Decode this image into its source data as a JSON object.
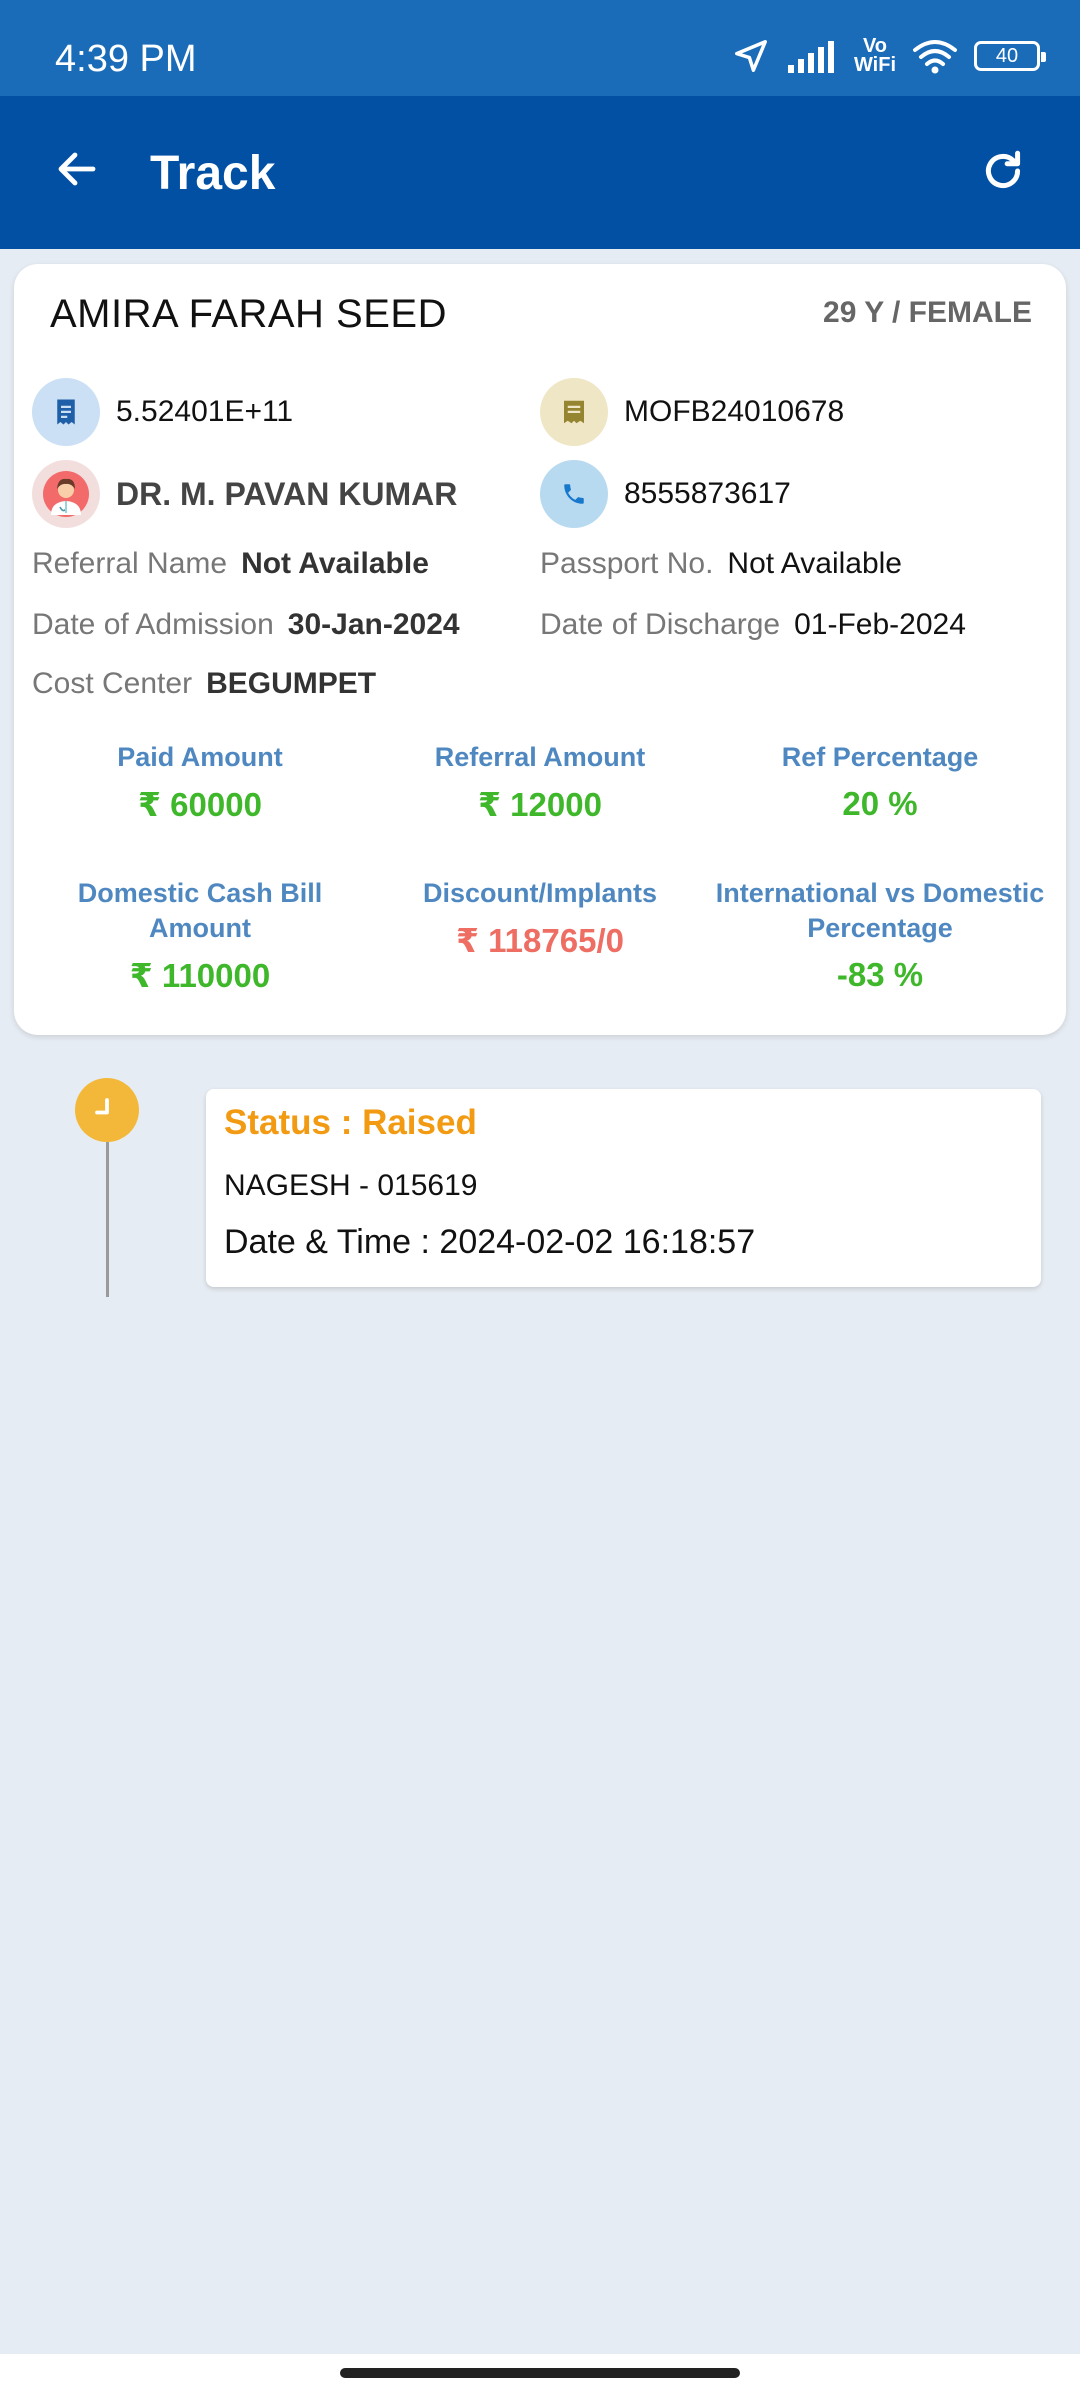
{
  "status_bar": {
    "time": "4:39 PM",
    "vowifi_top": "Vo",
    "vowifi_bottom": "WiFi",
    "battery": "40"
  },
  "app_bar": {
    "title": "Track"
  },
  "patient": {
    "name": "AMIRA FARAH SEED",
    "age_gender": "29 Y / FEMALE",
    "id_number": "5.52401E+11",
    "bill_number": "MOFB24010678",
    "doctor": "DR. M. PAVAN KUMAR",
    "phone": "8555873617",
    "referral_name_label": "Referral Name",
    "referral_name": "Not Available",
    "passport_label": "Passport No.",
    "passport": "Not Available",
    "admission_label": "Date of Admission",
    "admission_date": "30-Jan-2024",
    "discharge_label": "Date of Discharge",
    "discharge_date": "01-Feb-2024",
    "cost_center_label": "Cost Center",
    "cost_center": "BEGUMPET"
  },
  "stats": [
    {
      "label": "Paid Amount",
      "value": "₹ 60000"
    },
    {
      "label": "Referral Amount",
      "value": "₹ 12000"
    },
    {
      "label": "Ref Percentage",
      "value": "20 %"
    },
    {
      "label": "Domestic Cash Bill Amount",
      "value": "₹ 110000"
    },
    {
      "label": "Discount/Implants",
      "value": "₹ 118765/0"
    },
    {
      "label": "International  vs Domestic Percentage",
      "value": "-83 %"
    }
  ],
  "timeline": {
    "status": "Status : Raised",
    "user": "NAGESH - 015619",
    "datetime": "Date & Time : 2024-02-02 16:18:57"
  },
  "colors": {
    "status_bar": "#1a6cb9",
    "app_bar": "#0250a3",
    "background": "#e6ecf3",
    "stat_label": "#4f88c0",
    "positive": "#3fb72b",
    "negative": "#ee6e63",
    "status_raised": "#f29a12",
    "timeline_dot": "#f3b83a"
  },
  "icons": {
    "back": "arrow-left-icon",
    "refresh": "refresh-icon",
    "id": "receipt-icon",
    "bill": "document-icon",
    "doctor": "doctor-avatar-icon",
    "phone": "phone-icon",
    "timeline": "clock-icon"
  }
}
